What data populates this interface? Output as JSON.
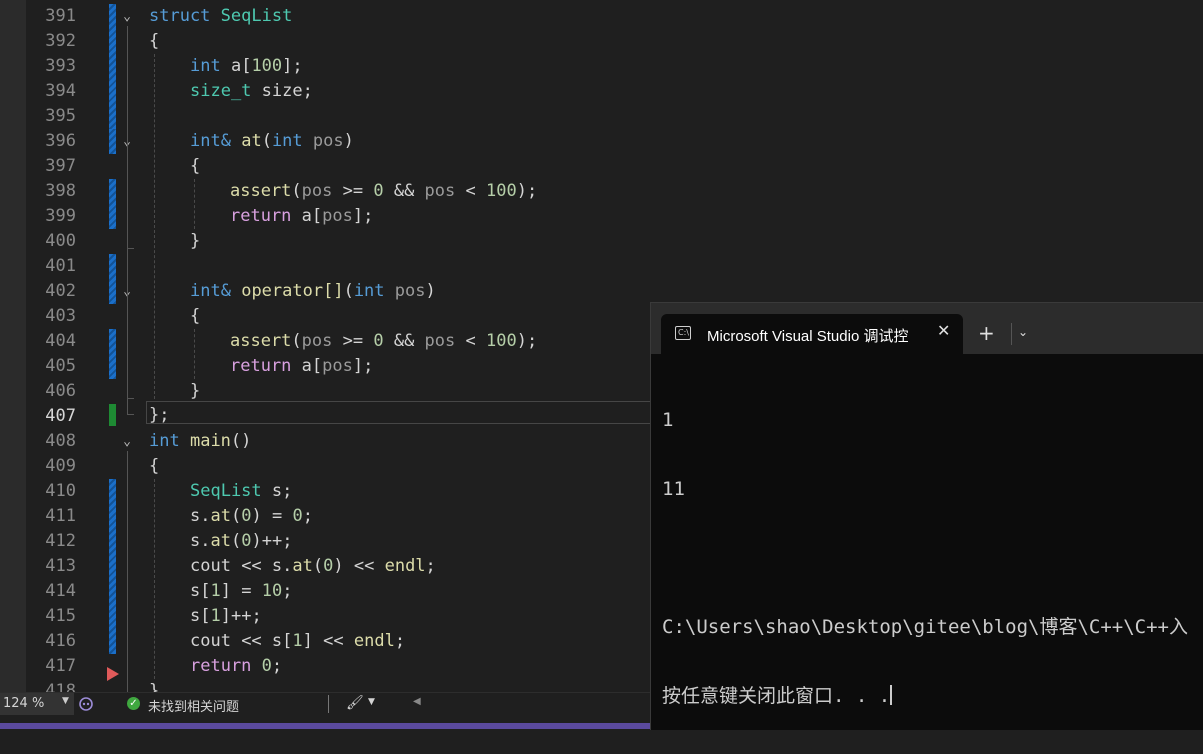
{
  "editor": {
    "line_numbers": [
      "391",
      "392",
      "393",
      "394",
      "395",
      "396",
      "397",
      "398",
      "399",
      "400",
      "401",
      "402",
      "403",
      "404",
      "405",
      "406",
      "407",
      "408",
      "409",
      "410",
      "411",
      "412",
      "413",
      "414",
      "415",
      "416",
      "417",
      "418"
    ],
    "active_line": "407",
    "tokens": {
      "struct": "struct",
      "SeqList": "SeqList",
      "lbrace": "{",
      "rbrace": "}",
      "rbrace_semi": "};",
      "int": "int",
      "a_arr": " a[",
      "n100": "100",
      "close_semi": "];",
      "size_t": "size_t",
      "size_decl": " size;",
      "intref": "int&",
      "at": "at",
      "lparen": "(",
      "rparen": ")",
      "pos": "pos",
      "assert": "assert",
      "ge": " >= ",
      "zero": "0",
      "andand": " && ",
      "lt": " < ",
      "rparen_semi": ");",
      "return": "return",
      "a_open": " a[",
      "close_bracket_semi": "];",
      "operator": "operator[]",
      "main": "main",
      "paren_pair": "()",
      "s_decl": " s;",
      "s_at": "s.",
      "eq": " = ",
      "semi": ";",
      "plusplus": "++;",
      "cout": "cout ",
      "shl": "<< ",
      "endl": "endl",
      "s_idx": "s[",
      "one": "1",
      "ten": "10",
      "close_bracket": "]",
      "sp": " "
    }
  },
  "statusbar": {
    "zoom": "124 %",
    "issues": "未找到相关问题"
  },
  "terminal": {
    "tab_title": "Microsoft Visual Studio 调试控",
    "tab_icon_text": "C:\\",
    "close_glyph": "✕",
    "new_tab_glyph": "+",
    "menu_glyph": "⌄",
    "output": [
      "1",
      "11",
      "",
      "C:\\Users\\shao\\Desktop\\gitee\\blog\\博客\\C++\\C++入",
      "按任意键关闭此窗口. . ."
    ]
  }
}
